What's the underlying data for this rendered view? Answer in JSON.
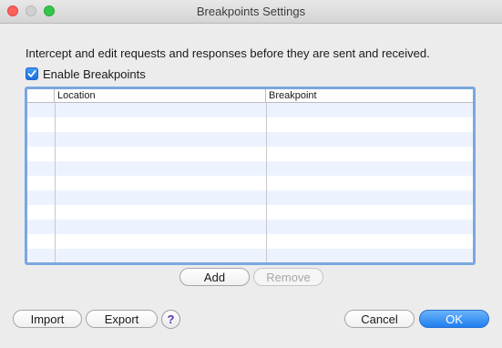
{
  "window": {
    "title": "Breakpoints Settings"
  },
  "description": "Intercept and edit requests and responses before they are sent and received.",
  "enable_breakpoints": {
    "label": "Enable Breakpoints",
    "checked": true
  },
  "table": {
    "columns": [
      "",
      "Location",
      "Breakpoint"
    ],
    "rows": []
  },
  "table_actions": {
    "add_label": "Add",
    "remove_label": "Remove"
  },
  "footer": {
    "import_label": "Import",
    "export_label": "Export",
    "help_label": "?",
    "cancel_label": "Cancel",
    "ok_label": "OK"
  },
  "colors": {
    "accent": "#1f7ff0",
    "row_alt": "#edf3fe",
    "help_glyph": "#5a2fb5"
  }
}
